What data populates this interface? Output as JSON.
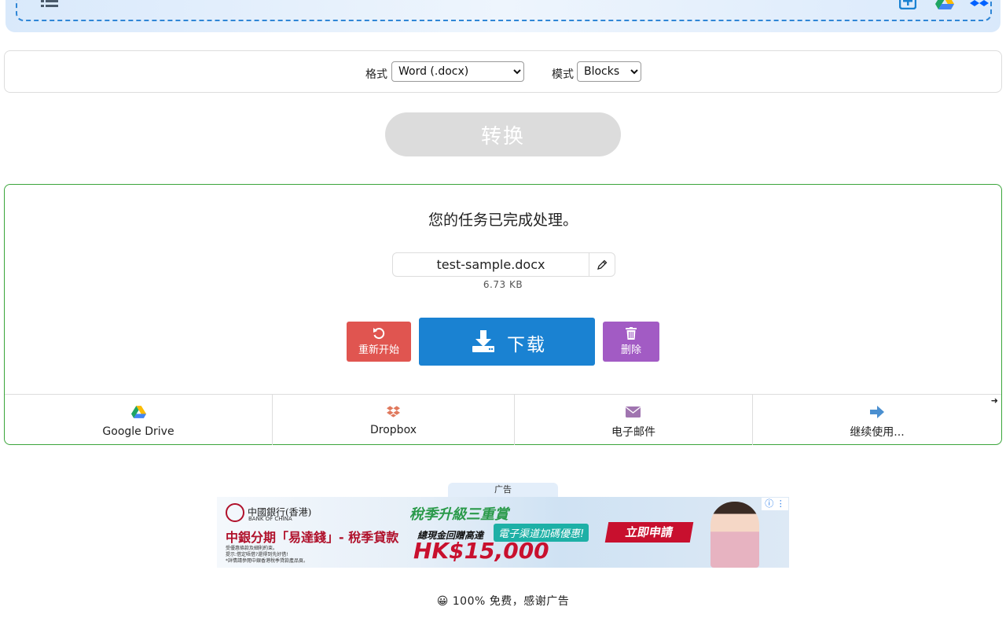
{
  "options": {
    "format_label": "格式",
    "format_value": "Word (.docx)",
    "mode_label": "模式",
    "mode_value": "Blocks"
  },
  "convert_label": "转换",
  "result": {
    "message": "您的任务已完成处理。",
    "file_name": "test-sample.docx",
    "file_size": "6.73 KB",
    "restart_label": "重新开始",
    "download_label": "下载",
    "delete_label": "删除"
  },
  "share": {
    "google_drive": "Google Drive",
    "dropbox": "Dropbox",
    "email": "电子邮件",
    "continue": "继续使用...",
    "arrow_glyph": "➜"
  },
  "ad": {
    "tab_label": "广告",
    "brand": "中國銀行(香港)",
    "brand_en": "BANK OF CHINA",
    "tagline": "稅季升級三重賞",
    "headline": "中銀分期「易達錢」- 稅季貸款",
    "subline": "總現金回贈高達",
    "channel_offer": "電子渠道加碼優惠!",
    "amount": "HK$15,000",
    "cta": "立即申請",
    "fine_print_1": "受優惠條款及細則約束。",
    "fine_print_2": "提示:借定唔借?還得到先好借!",
    "fine_print_3": "*詳情請參閱中銀香港稅季貸款產品頁。",
    "info_glyph": "ⓘ ⋮"
  },
  "footer_note": "😀 100% 免费，感谢广告",
  "colors": {
    "accent_blue": "#1a82d2",
    "restart_red": "#e05550",
    "delete_purple": "#a25bc4",
    "success_border": "#3aa53a"
  }
}
